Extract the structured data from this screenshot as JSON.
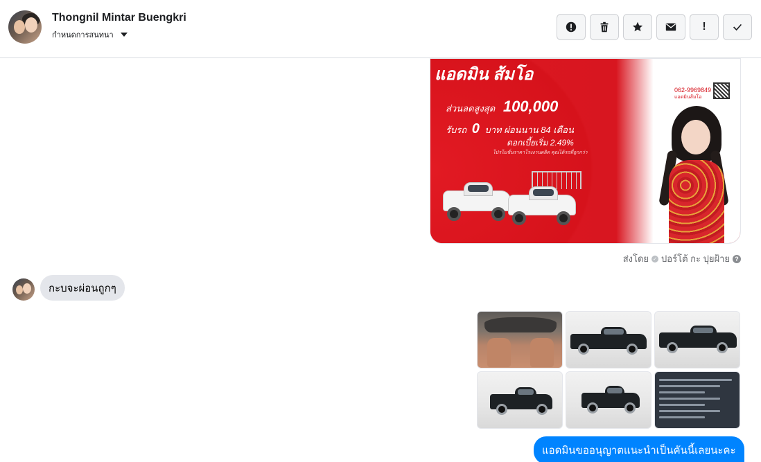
{
  "header": {
    "contact_name": "Thongnil Mintar Buengkri",
    "subtitle": "กำหนดการสนทนา",
    "actions": [
      {
        "label": "",
        "icon": "alert-circle-icon"
      },
      {
        "label": "",
        "icon": "trash-icon"
      },
      {
        "label": "",
        "icon": "star-icon"
      },
      {
        "label": "",
        "icon": "envelope-icon"
      },
      {
        "label": "!",
        "icon": "exclamation-icon"
      },
      {
        "label": "",
        "icon": "check-icon"
      }
    ]
  },
  "ad": {
    "title": "แอดมิน ส้มโอ",
    "line1_prefix": "ส่วนลดสูงสุด",
    "line1_value": "100,000",
    "line2_prefix": "รับรถ",
    "line2_value": "0",
    "line2_suffix": "บาท ผ่อนนาน 84 เดือน",
    "line3": "ดอกเบี้ยเริ่ม 2.49%",
    "line4": "โปรโมชั่นราคาโรงงานผลิต คุณได้รถที่ถูกกว่า",
    "phone": "062-9969849",
    "phone_caption": "แอดมินส้มโอ"
  },
  "sent_by": {
    "prefix": "ส่งโดย",
    "name": "ปอร์โต้ กะ ปุยฝ้าย",
    "help": "?"
  },
  "messages": {
    "incoming_text": "กะบจะผ่อนถูกๆ",
    "outgoing_text": "แอดมินขออนุญาตแนะนำเป็นคันนี้เลยนะคะ"
  },
  "photos": [
    {
      "kind": "interior"
    },
    {
      "kind": "exterior"
    },
    {
      "kind": "exterior"
    },
    {
      "kind": "exterior"
    },
    {
      "kind": "exterior"
    },
    {
      "kind": "spec-sheet"
    }
  ],
  "colors": {
    "accent_blue": "#0084ff",
    "bubble_gray": "#e4e6eb",
    "ad_red": "#d6121b"
  }
}
